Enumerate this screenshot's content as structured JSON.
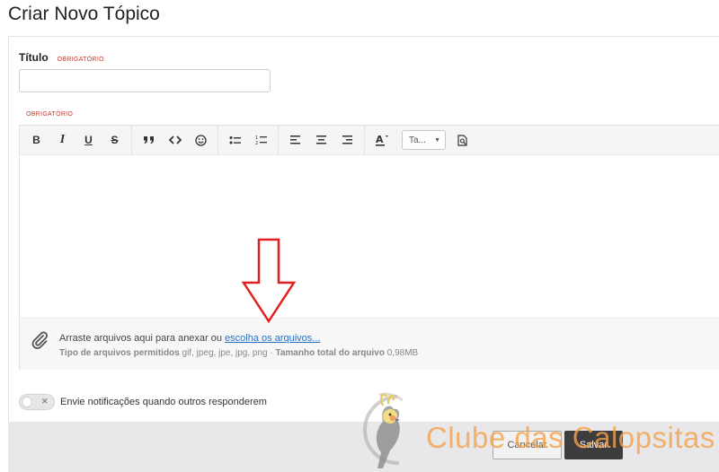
{
  "page": {
    "title": "Criar Novo Tópico"
  },
  "form": {
    "title_label": "Título",
    "required_badge": "OBRIGATÓRIO",
    "title_value": "",
    "body_required_badge": "OBRIGATÓRIO"
  },
  "toolbar": {
    "bold": "B",
    "italic": "I",
    "underline": "U",
    "strike": "S",
    "quote": "❞",
    "code": "<>",
    "emoji": "☺",
    "bullet_list": "•≡",
    "numbered_list": "1≡",
    "align_left": "≡",
    "align_center": "≡",
    "align_right": "≡",
    "text_color": "A",
    "font_size_value": "Ta...",
    "preview": "🔍"
  },
  "attachments": {
    "drop_text": "Arraste arquivos aqui para anexar ou ",
    "choose_link": "escolha os arquivos...",
    "types_label": "Tipo de arquivos permitidos",
    "types_value": " gif, jpeg, jpe, jpg, png · ",
    "size_label": "Tamanho total do arquivo",
    "size_value": " 0,98MB"
  },
  "notify": {
    "label": "Envie notificações quando outros responderem",
    "enabled": false
  },
  "footer": {
    "cancel_label": "Cancelar",
    "save_label": "Salvar"
  },
  "watermark": {
    "text": "Clube das Calopsitas"
  },
  "colors": {
    "required": "#c0392b",
    "link": "#2a6fbd",
    "save_button": "#3d3d3d",
    "annotation_arrow": "#e02020",
    "watermark": "#f5a14a"
  }
}
